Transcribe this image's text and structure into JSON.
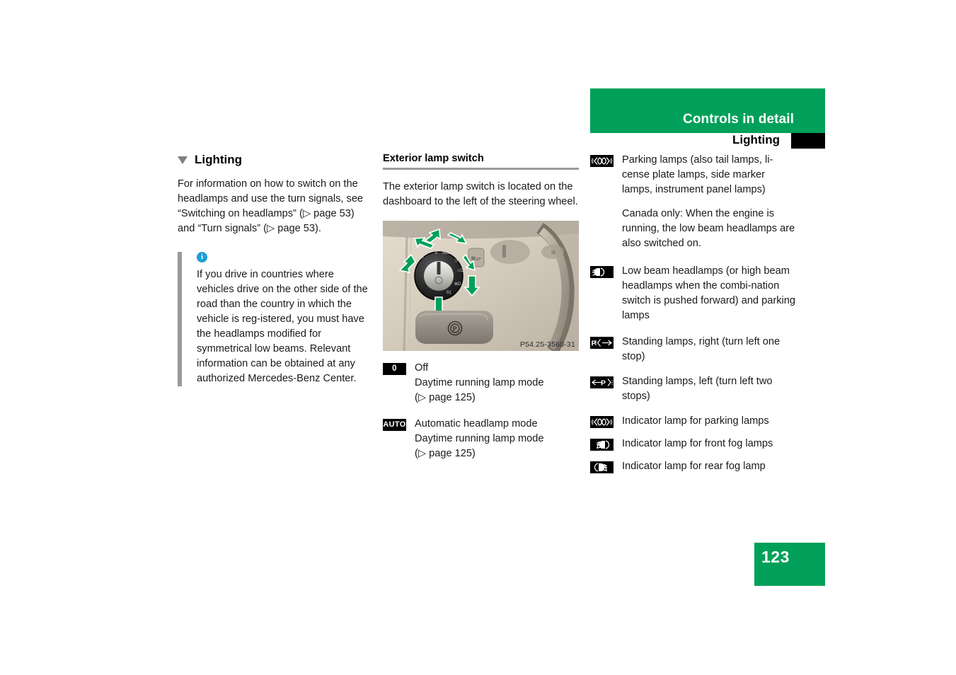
{
  "header": {
    "chapter_title": "Controls in detail",
    "section_title": "Lighting"
  },
  "left_column": {
    "section_heading": "Lighting",
    "intro_paragraph": "For information on how to switch on the headlamps and use the turn signals, see “Switching on headlamps” (▷ page 53) and “Turn signals” (▷ page 53).",
    "note": {
      "icon": "info-icon",
      "text": "If you drive in countries where vehicles drive on the other side of the road than the country in which the vehicle is reg-istered, you must have the headlamps modified for symmetrical low beams. Relevant information can be obtained at any authorized Mercedes-Benz Center."
    }
  },
  "middle_column": {
    "sub_heading": "Exterior lamp switch",
    "paragraph": "The exterior lamp switch is located on the dashboard to the left of the steering wheel.",
    "photo": {
      "alt": "Exterior lamp switch on dashboard with green arrows indicating rotation positions",
      "caption": "P54.25-3560-31"
    },
    "legend": [
      {
        "badge": "0",
        "badge_icon": "lamp-off-icon",
        "lines": [
          "Off",
          "Daytime running lamp mode",
          "(▷ page 125)"
        ]
      },
      {
        "badge": "AUTO",
        "badge_icon": "auto-headlamp-icon",
        "lines": [
          "Automatic headlamp mode",
          "Daytime running lamp mode",
          "(▷ page 125)"
        ]
      }
    ]
  },
  "right_column": {
    "legend": [
      {
        "badge_icon": "parking-lamps-icon",
        "text": "Parking lamps (also tail lamps, li-cense plate lamps, side marker lamps, instrument panel lamps)",
        "sub_text": "Canada only: When the engine is running, the low beam headlamps are also switched on."
      },
      {
        "badge_icon": "low-beam-headlamps-icon",
        "text": "Low beam headlamps (or high beam headlamps when the combi-nation switch is pushed forward) and parking lamps",
        "sub_text": ""
      },
      {
        "badge_icon": "standing-lamps-right-icon",
        "text": "Standing lamps, right (turn left one stop)",
        "sub_text": ""
      },
      {
        "badge_icon": "standing-lamps-left-icon",
        "text": "Standing lamps, left (turn left two stops)",
        "sub_text": ""
      },
      {
        "badge_icon": "parking-lamps-indicator-icon",
        "text": "Indicator lamp for parking lamps",
        "sub_text": ""
      },
      {
        "badge_icon": "front-fog-lamps-indicator-icon",
        "text": "Indicator lamp for front fog lamps",
        "sub_text": ""
      },
      {
        "badge_icon": "rear-fog-lamp-indicator-icon",
        "text": "Indicator lamp for rear fog lamp",
        "sub_text": ""
      }
    ]
  },
  "footer": {
    "page_number": "123"
  },
  "colors": {
    "brand_green": "#00a05a",
    "note_rule_grey": "#9a9a9a",
    "info_blue": "#1b9dd9",
    "badge_black": "#000000"
  }
}
